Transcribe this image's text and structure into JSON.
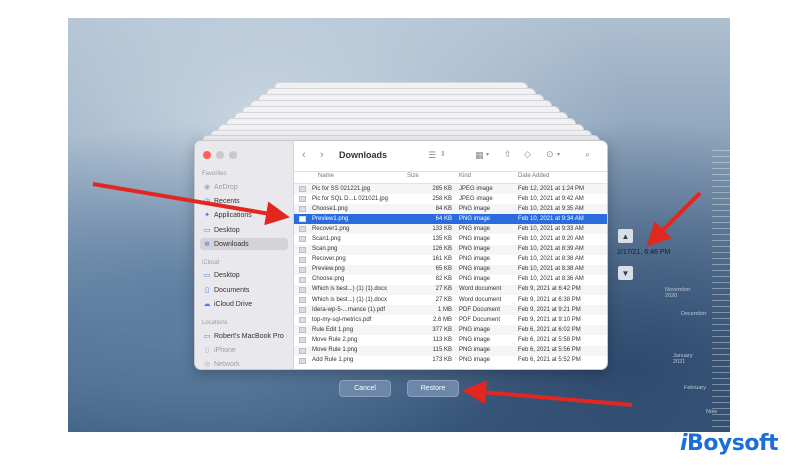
{
  "finder": {
    "title": "Downloads",
    "sidebar": {
      "favorites_header": "Favorites",
      "favorites": [
        {
          "label": "AirDrop",
          "icon": "airdrop-icon",
          "dim": true
        },
        {
          "label": "Recents",
          "icon": "clock-icon",
          "dim": false
        },
        {
          "label": "Applications",
          "icon": "apps-icon",
          "dim": false
        },
        {
          "label": "Desktop",
          "icon": "desktop-icon",
          "dim": false
        },
        {
          "label": "Downloads",
          "icon": "download-icon",
          "dim": false,
          "selected": true
        }
      ],
      "icloud_header": "iCloud",
      "icloud": [
        {
          "label": "Desktop",
          "icon": "desktop-icon"
        },
        {
          "label": "Documents",
          "icon": "document-icon"
        },
        {
          "label": "iCloud Drive",
          "icon": "cloud-icon"
        }
      ],
      "locations_header": "Locations",
      "locations": [
        {
          "label": "Robert's MacBook Pro",
          "icon": "laptop-icon",
          "dim": false
        },
        {
          "label": "iPhone",
          "icon": "phone-icon",
          "dim": true
        },
        {
          "label": "Network",
          "icon": "network-icon",
          "dim": true
        }
      ]
    },
    "columns": {
      "name": "Name",
      "size": "Size",
      "kind": "Kind",
      "date": "Date Added"
    },
    "files": [
      {
        "name": "Pic for SS 021221.jpg",
        "size": "285 KB",
        "kind": "JPEG image",
        "date": "Feb 12, 2021 at 1:24 PM"
      },
      {
        "name": "Pic for SQL D...L 021021.jpg",
        "size": "258 KB",
        "kind": "JPEG image",
        "date": "Feb 10, 2021 at 9:42 AM"
      },
      {
        "name": "Choose1.png",
        "size": "84 KB",
        "kind": "PNG image",
        "date": "Feb 10, 2021 at 9:35 AM"
      },
      {
        "name": "Preview1.png",
        "size": "64 KB",
        "kind": "PNG image",
        "date": "Feb 10, 2021 at 9:34 AM",
        "selected": true
      },
      {
        "name": "Recover1.png",
        "size": "133 KB",
        "kind": "PNG image",
        "date": "Feb 10, 2021 at 9:33 AM"
      },
      {
        "name": "Scan1.png",
        "size": "135 KB",
        "kind": "PNG image",
        "date": "Feb 10, 2021 at 9:20 AM"
      },
      {
        "name": "Scan.png",
        "size": "126 KB",
        "kind": "PNG image",
        "date": "Feb 10, 2021 at 8:39 AM"
      },
      {
        "name": "Recover.png",
        "size": "161 KB",
        "kind": "PNG image",
        "date": "Feb 10, 2021 at 8:38 AM"
      },
      {
        "name": "Preview.png",
        "size": "65 KB",
        "kind": "PNG image",
        "date": "Feb 10, 2021 at 8:38 AM"
      },
      {
        "name": "Choose.png",
        "size": "82 KB",
        "kind": "PNG image",
        "date": "Feb 10, 2021 at 8:36 AM"
      },
      {
        "name": "Which is best...) (1) (1).docx",
        "size": "27 KB",
        "kind": "Word document",
        "date": "Feb 9, 2021 at 6:42 PM"
      },
      {
        "name": "Which is best...) (1) (1).docx",
        "size": "27 KB",
        "kind": "Word document",
        "date": "Feb 9, 2021 at 6:38 PM"
      },
      {
        "name": "Idera-wp-5-...rnance (1).pdf",
        "size": "1 MB",
        "kind": "PDF Document",
        "date": "Feb 9, 2021 at 9:21 PM"
      },
      {
        "name": "top-my-sql-metrics.pdf",
        "size": "2.6 MB",
        "kind": "PDF Document",
        "date": "Feb 9, 2021 at 9:10 PM"
      },
      {
        "name": "Rule Edit 1.png",
        "size": "377 KB",
        "kind": "PNG image",
        "date": "Feb 6, 2021 at 6:02 PM"
      },
      {
        "name": "Move Rule 2.png",
        "size": "113 KB",
        "kind": "PNG image",
        "date": "Feb 6, 2021 at 5:58 PM"
      },
      {
        "name": "Move Rule 1.png",
        "size": "115 KB",
        "kind": "PNG image",
        "date": "Feb 6, 2021 at 5:56 PM"
      },
      {
        "name": "Add Rule 1.png",
        "size": "173 KB",
        "kind": "PNG image",
        "date": "Feb 6, 2021 at 5:52 PM"
      }
    ]
  },
  "buttons": {
    "cancel": "Cancel",
    "restore": "Restore"
  },
  "timemachine": {
    "timestamp": "2/17/21, 6:46 PM",
    "timeline": [
      "November 2020",
      "December",
      "January 2021",
      "February",
      "Now"
    ]
  },
  "brand": {
    "prefix": "i",
    "name": "Boysoft"
  },
  "colors": {
    "selection": "#2a6ce0",
    "arrow": "#e1271f",
    "brand": "#1c6fd4"
  }
}
